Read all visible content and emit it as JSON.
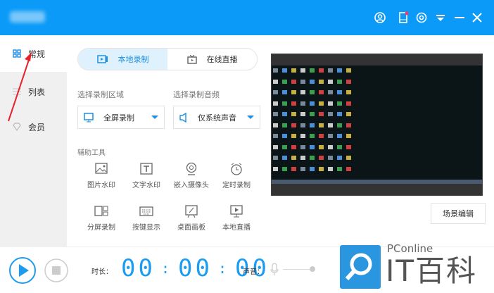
{
  "titlebar": {
    "icons": [
      "user-icon",
      "phone-icon",
      "settings-icon",
      "dropdown-menu-icon",
      "minimize-icon",
      "close-icon"
    ]
  },
  "sidebar": {
    "items": [
      {
        "label": "常规",
        "icon": "grid-icon"
      },
      {
        "label": "列表",
        "icon": "list-icon"
      },
      {
        "label": "会员",
        "icon": "diamond-icon"
      }
    ]
  },
  "tabs": [
    {
      "label": "本地录制",
      "icon": "record-icon"
    },
    {
      "label": "在线直播",
      "icon": "tv-icon"
    }
  ],
  "region": {
    "label": "选择录制区域",
    "value": "全屏录制"
  },
  "audio": {
    "label": "选择录制音频",
    "value": "仅系统声音"
  },
  "tools": {
    "label": "辅助工具",
    "items": [
      "图片水印",
      "文字水印",
      "嵌入摄像头",
      "定时录制",
      "分屏录制",
      "按键显示",
      "桌面画板",
      "本地直播"
    ]
  },
  "scene_button": "场景编辑",
  "bottom": {
    "duration_label": "时长：",
    "timer": [
      "00",
      "00",
      "00"
    ],
    "volume_label": "声音："
  },
  "watermark": {
    "brand": "PConline",
    "name": "IT百科"
  },
  "colors": {
    "accent": "#0b9af7",
    "timer": "#1c9cf0",
    "annotation_arrow": "#e8202a"
  }
}
